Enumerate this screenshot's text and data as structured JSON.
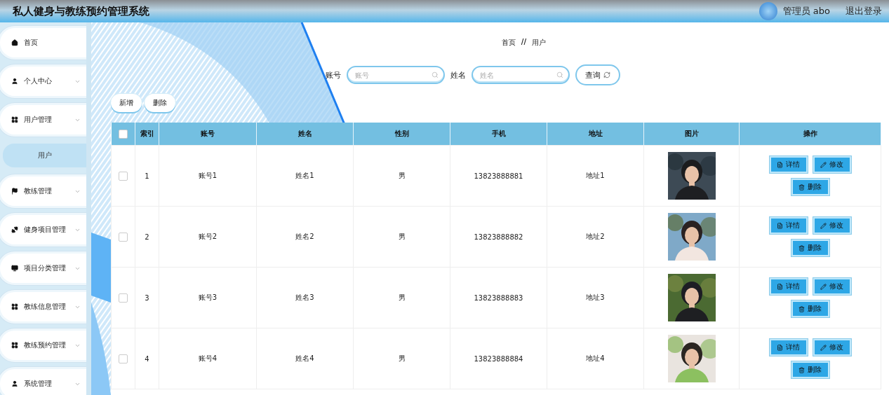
{
  "header": {
    "title": "私人健身与教练预约管理系统",
    "user": "管理员 abo",
    "logout": "退出登录"
  },
  "sidebar": {
    "items": [
      {
        "kind": "link",
        "label": "首页"
      },
      {
        "kind": "menu",
        "label": "个人中心"
      },
      {
        "kind": "menu",
        "label": "用户管理",
        "children": [
          {
            "label": "用户",
            "selected": true
          }
        ]
      },
      {
        "kind": "menu",
        "label": "教练管理"
      },
      {
        "kind": "menu",
        "label": "健身项目管理"
      },
      {
        "kind": "menu",
        "label": "项目分类管理"
      },
      {
        "kind": "menu",
        "label": "教练信息管理"
      },
      {
        "kind": "menu",
        "label": "教练预约管理"
      },
      {
        "kind": "menu",
        "label": "系统管理"
      }
    ]
  },
  "breadcrumb": [
    "首页",
    "//",
    "用户"
  ],
  "search": {
    "fields": [
      {
        "label": "账号",
        "placeholder": "账号"
      },
      {
        "label": "姓名",
        "placeholder": "姓名"
      }
    ],
    "button": "查询"
  },
  "actions": [
    "新增",
    "删除"
  ],
  "table": {
    "all_checked": false,
    "columns": [
      "索引",
      "账号",
      "姓名",
      "性别",
      "手机",
      "地址",
      "图片",
      "操作"
    ],
    "rows": [
      {
        "checked": false,
        "cells": [
          "1",
          "账号1",
          "姓名1",
          "男",
          "13823888881",
          "地址1"
        ],
        "picture": {
          "kind": "picture"
        },
        "buttons": [
          "详情",
          "修改",
          "删除"
        ]
      },
      {
        "checked": false,
        "cells": [
          "2",
          "账号2",
          "姓名2",
          "男",
          "13823888882",
          "地址2"
        ],
        "picture": {
          "kind": "picture"
        },
        "buttons": [
          "详情",
          "修改",
          "删除"
        ]
      },
      {
        "checked": false,
        "cells": [
          "3",
          "账号3",
          "姓名3",
          "男",
          "13823888883",
          "地址3"
        ],
        "picture": {
          "kind": "picture"
        },
        "buttons": [
          "详情",
          "修改",
          "删除"
        ]
      },
      {
        "checked": false,
        "cells": [
          "4",
          "账号4",
          "姓名4",
          "男",
          "13823888884",
          "地址4"
        ],
        "picture": {
          "kind": "picture"
        },
        "buttons": [
          "详情",
          "修改",
          "删除"
        ]
      }
    ]
  }
}
